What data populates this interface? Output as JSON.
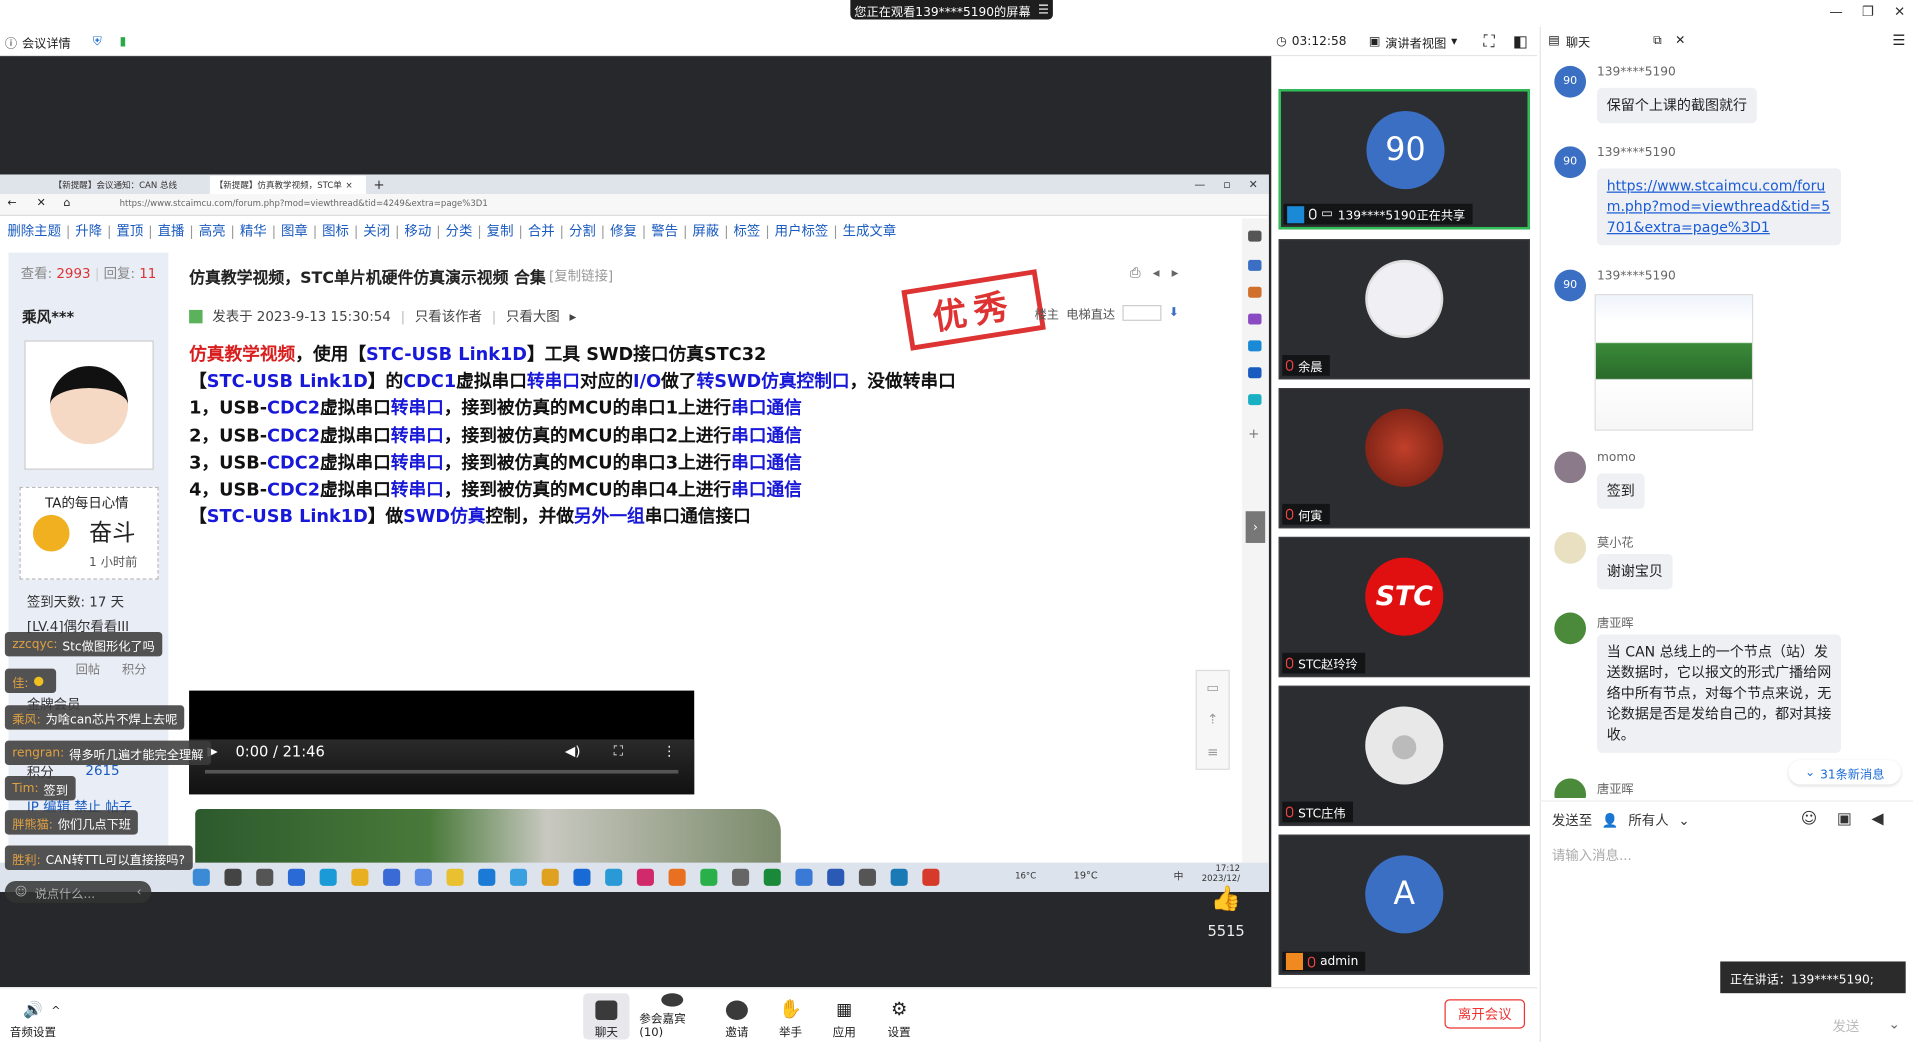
{
  "banner": {
    "text": "您正在观看139****5190的屏幕"
  },
  "toolbar": {
    "meeting_info": "会议详情",
    "timer": "03:12:58",
    "view_mode": "演讲者视图"
  },
  "browser": {
    "tab1": "【新提醒】会议通知：CAN 总线",
    "tab2": "【新提醒】仿真教学视频，STC单",
    "url": "https://www.stcaimcu.com/forum.php?mod=viewthread&tid=4249&extra=page%3D1",
    "admin_links": [
      "删除主题",
      "升降",
      "置顶",
      "直播",
      "高亮",
      "精华",
      "图章",
      "图标",
      "关闭",
      "移动",
      "分类",
      "复制",
      "合并",
      "分割",
      "修复",
      "警告",
      "屏蔽",
      "标签",
      "用户标签",
      "生成文章"
    ]
  },
  "post": {
    "views_label": "查看:",
    "views": "2993",
    "replies_label": "回复:",
    "replies": "11",
    "author": "乘风***",
    "mood_label": "TA的每日心情",
    "mood": "奋斗",
    "mood_time": "1 小时前",
    "sign_days": "签到天数: 17 天",
    "level": "[LV.4]偶尔看看III",
    "stat_labels": [
      "回帖",
      "积分"
    ],
    "gold_member": "金牌会员",
    "points_label": "积分",
    "points": "2615",
    "admin_actions": "IP 编辑 禁止 帖子",
    "title": "仿真教学视频，STC单片机硬件仿真演示视频 合集",
    "copy_link": "[复制链接]",
    "posted": "发表于 2023-9-13 15:30:54",
    "only_author": "只看该作者",
    "big_image": "只看大图",
    "stamp": "优秀",
    "floor_owner": "楼主",
    "elevator": "电梯直达",
    "video_time": "0:00 / 21:46"
  },
  "content_lines": [
    [
      {
        "t": "仿真教学视频",
        "c": "red"
      },
      {
        "t": "，使用【"
      },
      {
        "t": "STC-USB Link1D",
        "c": "blue"
      },
      {
        "t": "】工具 SWD接口仿真STC32"
      }
    ],
    [
      {
        "t": "【"
      },
      {
        "t": "STC-USB Link1D",
        "c": "blue"
      },
      {
        "t": "】的"
      },
      {
        "t": "CDC1",
        "c": "blue"
      },
      {
        "t": "虚拟串口"
      },
      {
        "t": "转串口",
        "c": "blue"
      },
      {
        "t": "对应的"
      },
      {
        "t": "I/O",
        "c": "blue"
      },
      {
        "t": "做了"
      },
      {
        "t": "转SWD仿真控制口",
        "c": "blue"
      },
      {
        "t": "，没做转串口"
      }
    ],
    [
      {
        "t": "1，USB-"
      },
      {
        "t": "CDC2",
        "c": "blue"
      },
      {
        "t": "虚拟串口"
      },
      {
        "t": "转串口",
        "c": "blue"
      },
      {
        "t": "，接到被仿真的MCU的串口1上进行"
      },
      {
        "t": "串口通信",
        "c": "blue"
      }
    ],
    [
      {
        "t": "2，USB-"
      },
      {
        "t": "CDC2",
        "c": "blue"
      },
      {
        "t": "虚拟串口"
      },
      {
        "t": "转串口",
        "c": "blue"
      },
      {
        "t": "，接到被仿真的MCU的串口2上进行"
      },
      {
        "t": "串口通信",
        "c": "blue"
      }
    ],
    [
      {
        "t": "3，USB-"
      },
      {
        "t": "CDC2",
        "c": "blue"
      },
      {
        "t": "虚拟串口"
      },
      {
        "t": "转串口",
        "c": "blue"
      },
      {
        "t": "，接到被仿真的MCU的串口3上进行"
      },
      {
        "t": "串口通信",
        "c": "blue"
      }
    ],
    [
      {
        "t": "4，USB-"
      },
      {
        "t": "CDC2",
        "c": "blue"
      },
      {
        "t": "虚拟串口"
      },
      {
        "t": "转串口",
        "c": "blue"
      },
      {
        "t": "，接到被仿真的MCU的串口4上进行"
      },
      {
        "t": "串口通信",
        "c": "blue"
      }
    ],
    [
      {
        "t": "【"
      },
      {
        "t": "STC-USB Link1D",
        "c": "blue"
      },
      {
        "t": "】做"
      },
      {
        "t": "SWD仿真",
        "c": "blue"
      },
      {
        "t": "控制，并做"
      },
      {
        "t": "另外一组",
        "c": "blue"
      },
      {
        "t": "串口通信接口"
      }
    ]
  ],
  "taskbar": {
    "weather1": "16°C",
    "weather2": "19°C",
    "ime": "中",
    "time": "17:12",
    "date": "2023/12/"
  },
  "danmu": [
    {
      "name": "zzcqyc:",
      "text": "Stc做图形化了吗"
    },
    {
      "name": "佳:",
      "text": ""
    },
    {
      "name": "乘风:",
      "text": "为啥can芯片不焊上去呢"
    },
    {
      "name": "rengran:",
      "text": "得多听几遍才能完全理解"
    },
    {
      "name": "Tim:",
      "text": "签到"
    },
    {
      "name": "胖熊猫:",
      "text": "你们几点下班"
    },
    {
      "name": "胜利:",
      "text": "CAN转TTL可以直接接吗?"
    }
  ],
  "chat_input_placeholder": "说点什么...",
  "likes": "5515",
  "tiles": [
    {
      "avatar": "90",
      "label": "139****5190正在共享",
      "color": "#3a6fc4"
    },
    {
      "avatar": "",
      "label": "余晨",
      "color": "#f0f0f4"
    },
    {
      "avatar": "",
      "label": "何寅",
      "color": "#7a2020"
    },
    {
      "avatar": "STC",
      "label": "STC赵玲玲",
      "color": "#e01010"
    },
    {
      "avatar": "",
      "label": "STC庄伟",
      "color": "#e6e6e6"
    },
    {
      "avatar": "A",
      "label": "admin",
      "color": "#3a6fc4"
    }
  ],
  "chat": {
    "title": "聊天",
    "messages": [
      {
        "avatar": "90",
        "name": "139****5190",
        "text": "保留个上课的截图就行"
      },
      {
        "avatar": "90",
        "name": "139****5190",
        "link": "https://www.stcaimcu.com/forum.php?mod=viewthread&tid=5701&extra=page%3D1"
      },
      {
        "avatar": "90",
        "name": "139****5190",
        "image": "screenshot"
      },
      {
        "avatar": "",
        "name": "momo",
        "text": "签到"
      },
      {
        "avatar": "",
        "name": "莫小花",
        "text": "谢谢宝贝"
      },
      {
        "avatar": "",
        "name": "唐亚晖",
        "text": "当 CAN 总线上的一个节点（站）发送数据时，它以报文的形式广播给网络中所有节点，对每个节点来说，无论数据是否是发给自己的，都对其接收。"
      },
      {
        "avatar": "",
        "name": "唐亚晖",
        "text": ""
      }
    ],
    "new_messages": "31条新消息",
    "send_to_label": "发送至",
    "send_to_value": "所有人",
    "input_placeholder": "请输入消息...",
    "speaking": "正在讲话：139****5190;",
    "send": "发送"
  },
  "bottom": {
    "audio": "音频设置",
    "buttons": [
      "聊天",
      "参会嘉宾(10)",
      "邀请",
      "举手",
      "应用",
      "设置"
    ],
    "leave": "离开会议"
  }
}
